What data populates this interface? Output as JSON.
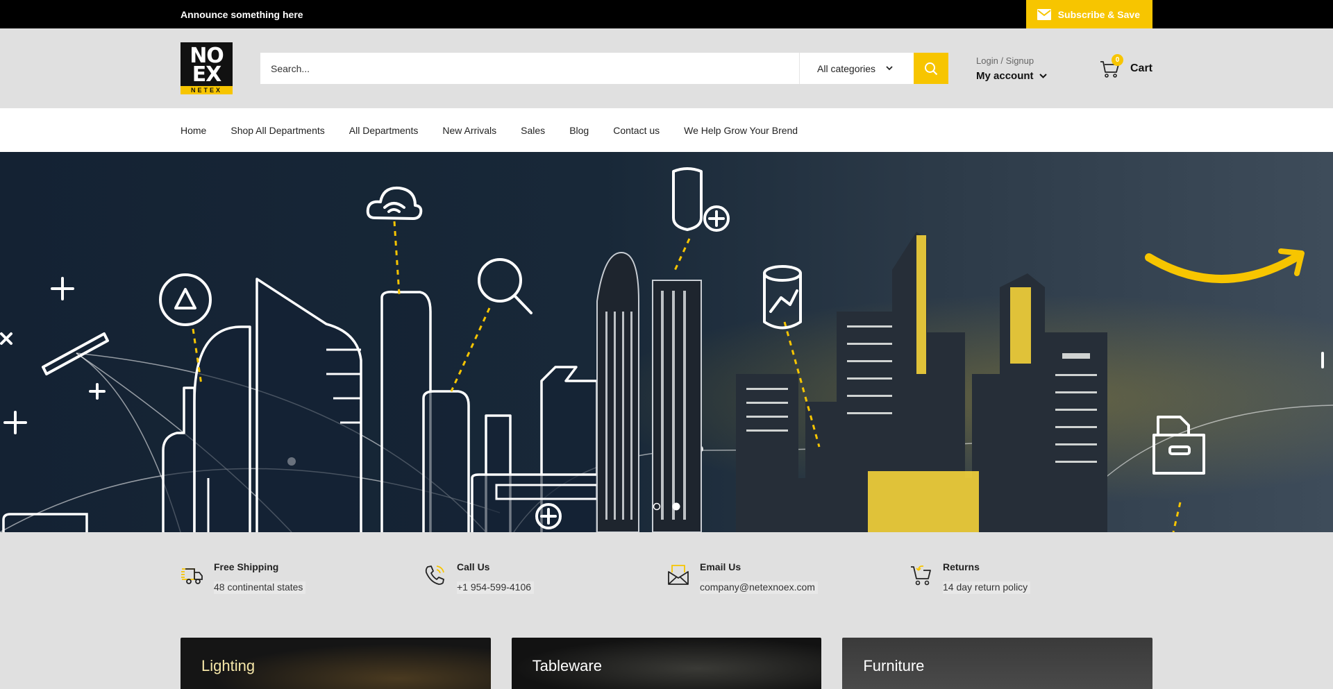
{
  "announcement": {
    "text": "Announce something here",
    "subscribe_label": "Subscribe & Save"
  },
  "header": {
    "logo": {
      "line1": "NO",
      "line2": "EX",
      "line3": "NETEX"
    },
    "search": {
      "placeholder": "Search...",
      "category_selected": "All categories"
    },
    "account": {
      "login_label": "Login / Signup",
      "account_label": "My account"
    },
    "cart": {
      "label": "Cart",
      "count": "0"
    }
  },
  "nav": {
    "items": [
      {
        "label": "Home"
      },
      {
        "label": "Shop All Departments"
      },
      {
        "label": "All Departments"
      },
      {
        "label": "New Arrivals"
      },
      {
        "label": "Sales"
      },
      {
        "label": "Blog"
      },
      {
        "label": "Contact us"
      },
      {
        "label": "We Help Grow Your Brend"
      }
    ]
  },
  "hero": {
    "slides_count": 2,
    "active_slide": 2
  },
  "features": [
    {
      "icon": "truck-icon",
      "title": "Free Shipping",
      "subtitle": "48 continental states"
    },
    {
      "icon": "phone-icon",
      "title": "Call Us",
      "subtitle": "+1 954-599-4106"
    },
    {
      "icon": "envelope-icon",
      "title": "Email Us",
      "subtitle": "company@netexnoex.com"
    },
    {
      "icon": "cart-return-icon",
      "title": "Returns",
      "subtitle": "14 day return policy"
    }
  ],
  "categories": [
    {
      "label": "Lighting"
    },
    {
      "label": "Tableware"
    },
    {
      "label": "Furniture"
    }
  ],
  "colors": {
    "accent": "#f7c500",
    "topbar": "#000000",
    "header_bg": "#e0e0e0"
  }
}
